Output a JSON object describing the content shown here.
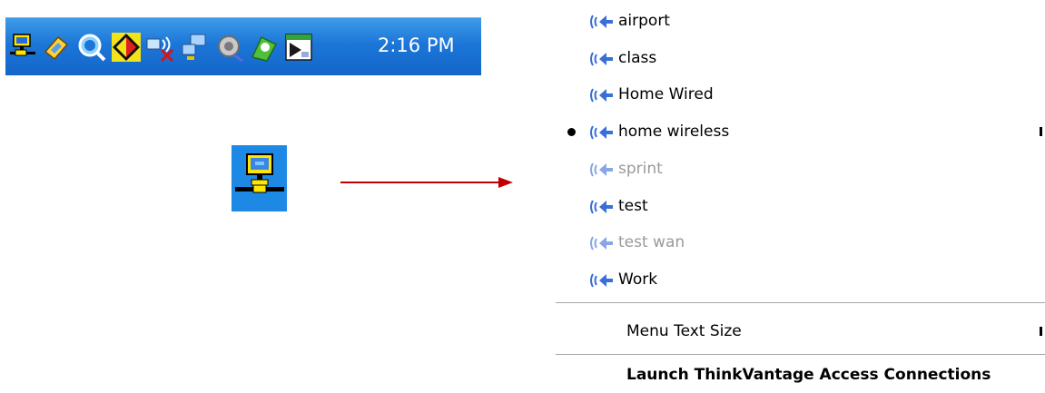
{
  "taskbar": {
    "clock": "2:16 PM",
    "icons": [
      "network-icon",
      "pencil-icon",
      "search-icon",
      "diamond-icon",
      "network-disconnected-icon",
      "connection-icon",
      "speaker-icon",
      "update-icon",
      "window-icon"
    ]
  },
  "menu": {
    "profiles": [
      {
        "label": "airport",
        "selected": false,
        "disabled": false
      },
      {
        "label": "class",
        "selected": false,
        "disabled": false
      },
      {
        "label": "Home Wired",
        "selected": false,
        "disabled": false
      },
      {
        "label": "home wireless",
        "selected": true,
        "disabled": false
      },
      {
        "label": "sprint",
        "selected": false,
        "disabled": true
      },
      {
        "label": "test",
        "selected": false,
        "disabled": false
      },
      {
        "label": "test wan",
        "selected": false,
        "disabled": true
      },
      {
        "label": "Work",
        "selected": false,
        "disabled": false
      }
    ],
    "text_size_label": "Menu Text Size",
    "launch_label": "Launch ThinkVantage Access Connections"
  },
  "colors": {
    "taskbar": "#1b76d8",
    "wireless_icon": "#3a6fd8",
    "arrow": "#c00000",
    "disabled_text": "#9a9a9a"
  }
}
